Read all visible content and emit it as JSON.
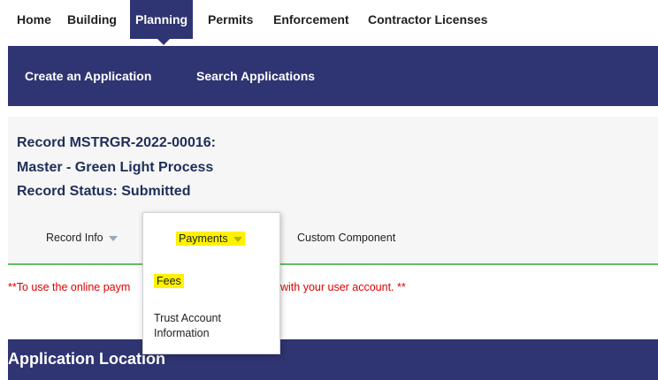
{
  "topnav": {
    "items": [
      "Home",
      "Building",
      "Planning",
      "Permits",
      "Enforcement",
      "Contractor Licenses"
    ]
  },
  "subnav": {
    "create": "Create an Application",
    "search": "Search Applications"
  },
  "record": {
    "number_line": "Record MSTRGR-2022-00016:",
    "type_line": "Master - Green Light Process",
    "status_line": "Record Status: Submitted"
  },
  "tabs": {
    "record_info": "Record Info",
    "payments": "Payments",
    "custom_component": "Custom Component"
  },
  "dropdown": {
    "fees": "Fees",
    "trust_line1": "Trust Account",
    "trust_line2": "Information"
  },
  "warning": {
    "left": "**To use the online paym",
    "right": "with your user account. **"
  },
  "location": {
    "title": "Application Location"
  },
  "colors": {
    "nav_bg": "#2f3472",
    "highlight": "#fff200",
    "warning": "#e00000",
    "tab_underline": "#5fbf60"
  }
}
